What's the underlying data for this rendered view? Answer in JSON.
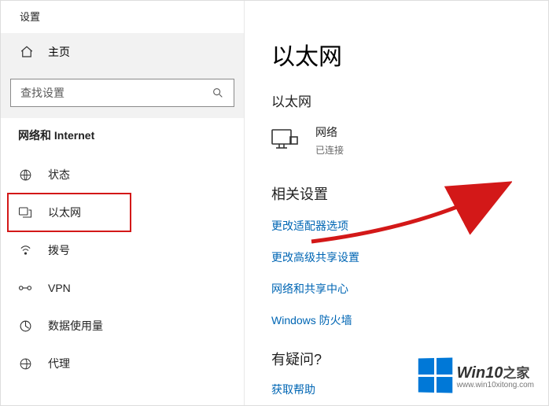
{
  "window_title": "设置",
  "home_label": "主页",
  "search_placeholder": "查找设置",
  "category": "网络和 Internet",
  "nav": {
    "items": [
      {
        "label": "状态"
      },
      {
        "label": "以太网"
      },
      {
        "label": "拨号"
      },
      {
        "label": "VPN"
      },
      {
        "label": "数据使用量"
      },
      {
        "label": "代理"
      }
    ]
  },
  "page": {
    "title": "以太网",
    "subtitle": "以太网",
    "network": {
      "name": "网络",
      "status": "已连接"
    }
  },
  "related": {
    "heading": "相关设置",
    "links": [
      "更改适配器选项",
      "更改高级共享设置",
      "网络和共享中心",
      "Windows 防火墙"
    ]
  },
  "question": {
    "heading": "有疑问?",
    "link": "获取帮助"
  },
  "watermark": {
    "brand": "Win10",
    "suffix": "之家",
    "url": "www.win10xitong.com"
  }
}
